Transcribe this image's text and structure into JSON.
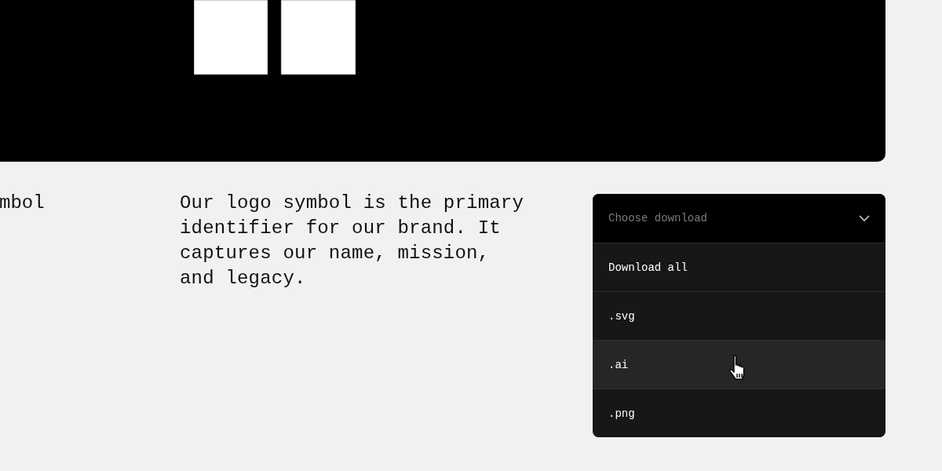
{
  "section_label": "mbol",
  "description": "Our logo symbol is the primary identifier for our brand. It captures our name, mission, and legacy.",
  "dropdown": {
    "placeholder": "Choose download",
    "expanded": true,
    "options": [
      {
        "label": "Download all",
        "selected": false
      },
      {
        "label": ".svg",
        "selected": false
      },
      {
        "label": ".ai",
        "selected": true
      },
      {
        "label": ".png",
        "selected": false
      }
    ]
  }
}
